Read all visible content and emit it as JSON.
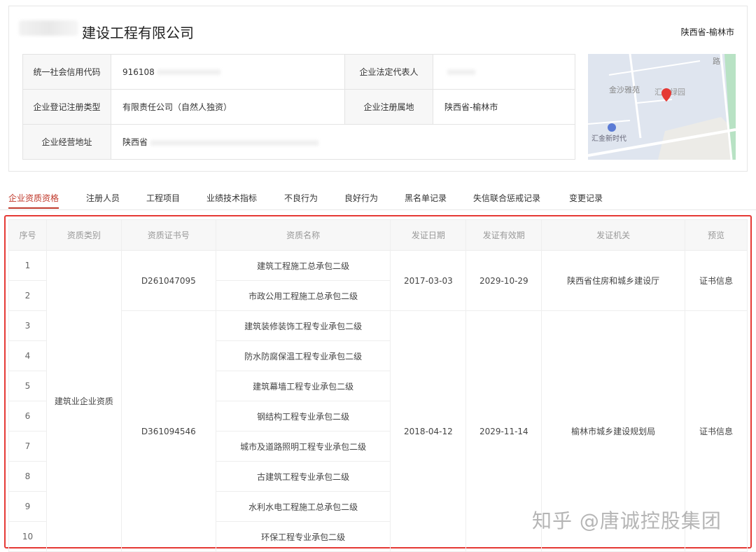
{
  "company": {
    "title": "建设工程有限公司",
    "region": "陕西省-榆林市"
  },
  "info": {
    "credit_code_label": "统一社会信用代码",
    "credit_code": "916108",
    "legal_rep_label": "企业法定代表人",
    "legal_rep": "",
    "reg_type_label": "企业登记注册类型",
    "reg_type": "有限责任公司（自然人独资）",
    "reg_place_label": "企业注册属地",
    "reg_place": "陕西省-榆林市",
    "address_label": "企业经营地址",
    "address": "陕西省"
  },
  "map": {
    "labels": [
      "金沙雅苑",
      "汇金绿园",
      "汇金新时代",
      "路"
    ]
  },
  "tabs": [
    "企业资质资格",
    "注册人员",
    "工程项目",
    "业绩技术指标",
    "不良行为",
    "良好行为",
    "黑名单记录",
    "失信联合惩戒记录",
    "变更记录"
  ],
  "table": {
    "headers": [
      "序号",
      "资质类别",
      "资质证书号",
      "资质名称",
      "发证日期",
      "发证有效期",
      "发证机关",
      "预览"
    ],
    "category": "建筑业企业资质",
    "groups": [
      {
        "cert_no": "D261047095",
        "issue_date": "2017-03-03",
        "valid_until": "2029-10-29",
        "authority": "陕西省住房和城乡建设厅",
        "preview": "证书信息",
        "items": [
          {
            "seq": "1",
            "name": "建筑工程施工总承包二级"
          },
          {
            "seq": "2",
            "name": "市政公用工程施工总承包二级"
          }
        ]
      },
      {
        "cert_no": "D361094546",
        "issue_date": "2018-04-12",
        "valid_until": "2029-11-14",
        "authority": "榆林市城乡建设规划局",
        "preview": "证书信息",
        "items": [
          {
            "seq": "3",
            "name": "建筑装修装饰工程专业承包二级"
          },
          {
            "seq": "4",
            "name": "防水防腐保温工程专业承包二级"
          },
          {
            "seq": "5",
            "name": "建筑幕墙工程专业承包二级"
          },
          {
            "seq": "6",
            "name": "钢结构工程专业承包二级"
          },
          {
            "seq": "7",
            "name": "城市及道路照明工程专业承包二级"
          },
          {
            "seq": "8",
            "name": "古建筑工程专业承包二级"
          },
          {
            "seq": "9",
            "name": "水利水电工程施工总承包二级"
          },
          {
            "seq": "10",
            "name": "环保工程专业承包二级"
          }
        ]
      }
    ]
  },
  "watermark": "知乎 @唐诚控股集团"
}
